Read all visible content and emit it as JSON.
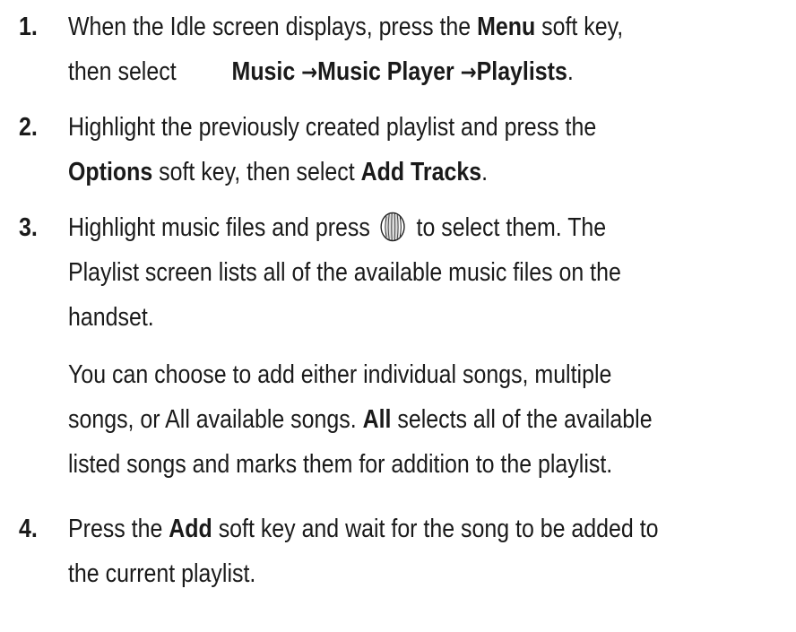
{
  "steps": [
    {
      "number": "1.",
      "lines": [
        {
          "parts": [
            {
              "t": "When the Idle screen displays, press the ",
              "b": false
            },
            {
              "t": "Menu",
              "b": true
            },
            {
              "t": " soft key,",
              "b": false
            }
          ]
        },
        {
          "parts": [
            {
              "t": "then select",
              "b": false
            },
            {
              "gap": true
            },
            {
              "t": "Music ",
              "b": true
            },
            {
              "arrow": "→"
            },
            {
              "t": "Music Player ",
              "b": true
            },
            {
              "arrow": "→"
            },
            {
              "t": "Playlists",
              "b": true
            },
            {
              "t": ".",
              "b": false
            }
          ]
        }
      ]
    },
    {
      "number": "2.",
      "lines": [
        {
          "parts": [
            {
              "t": "Highlight the previously created playlist and press the",
              "b": false
            }
          ]
        },
        {
          "parts": [
            {
              "t": "Options",
              "b": true
            },
            {
              "t": " soft key, then select ",
              "b": false
            },
            {
              "t": "Add Tracks",
              "b": true
            },
            {
              "t": ".",
              "b": false
            }
          ]
        }
      ]
    },
    {
      "number": "3.",
      "lines": [
        {
          "parts": [
            {
              "t": "Highlight music files and press ",
              "b": false
            },
            {
              "icon": "select-key-icon"
            },
            {
              "t": " to select them. The",
              "b": false
            }
          ]
        },
        {
          "parts": [
            {
              "t": "Playlist screen lists all of the available music files on the",
              "b": false
            }
          ]
        },
        {
          "parts": [
            {
              "t": "handset.",
              "b": false
            }
          ]
        },
        {
          "parts": [
            {
              "t": "You can choose to add either individual songs, multiple",
              "b": false
            }
          ]
        },
        {
          "parts": [
            {
              "t": "songs, or All available songs. ",
              "b": false
            },
            {
              "t": "All",
              "b": true
            },
            {
              "t": " selects all of the available",
              "b": false
            }
          ]
        },
        {
          "parts": [
            {
              "t": "listed songs and marks them for addition to the playlist.",
              "b": false
            }
          ]
        }
      ]
    },
    {
      "number": "4.",
      "lines": [
        {
          "parts": [
            {
              "t": "Press the ",
              "b": false
            },
            {
              "t": "Add",
              "b": true
            },
            {
              "t": " soft key and wait for the song to be added to",
              "b": false
            }
          ]
        },
        {
          "parts": [
            {
              "t": "the current playlist.",
              "b": false
            }
          ]
        }
      ]
    }
  ]
}
